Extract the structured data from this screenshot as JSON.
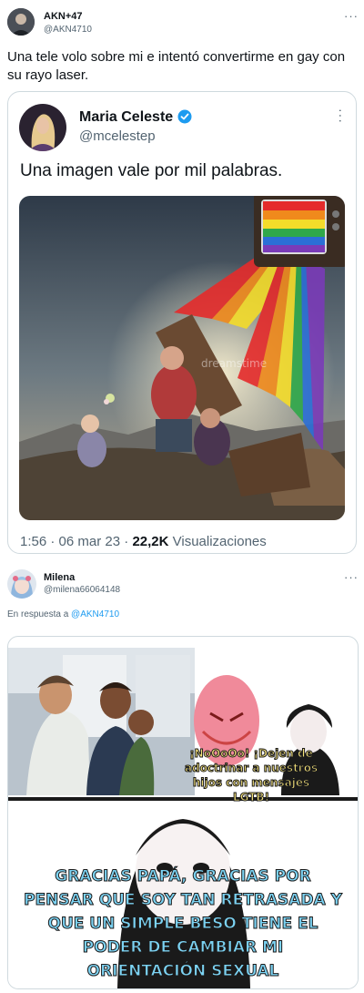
{
  "tweet": {
    "author_name": "AKN+47",
    "author_handle": "@AKN4710",
    "text": "Una tele volo sobre mi e intentó convertirme en gay con su rayo laser.",
    "more_icon": "more-horizontal-icon"
  },
  "quoted": {
    "author_name": "Maria Celeste",
    "author_handle": "@mcelestep",
    "verified": true,
    "text": "Una imagen vale por mil palabras.",
    "time": "1:56",
    "date": "06 mar 23",
    "views_count": "22,2K",
    "views_label": "Visualizaciones",
    "watermark": "dreamstime"
  },
  "reply": {
    "author_name": "Milena",
    "author_handle": "@milena66064148",
    "reply_prefix": "En respuesta a",
    "reply_to": "@AKN4710",
    "meme_top_text": "¡NoOoOo! ¡Dejen de adoctrinar a nuestros hijos con mensajes LGTB!",
    "meme_bottom_text": "GRACIAS PAPÁ, GRACIAS POR PENSAR QUE SOY TAN RETRASADA Y QUE UN SIMPLE BESO TIENE EL PODER DE CAMBIAR MI ORIENTACIÓN SEXUAL"
  },
  "colors": {
    "link": "#1d9bf0",
    "secondary_text": "#536471",
    "verified": "#1d9bf0",
    "meme_text": "#7cd3f3"
  }
}
